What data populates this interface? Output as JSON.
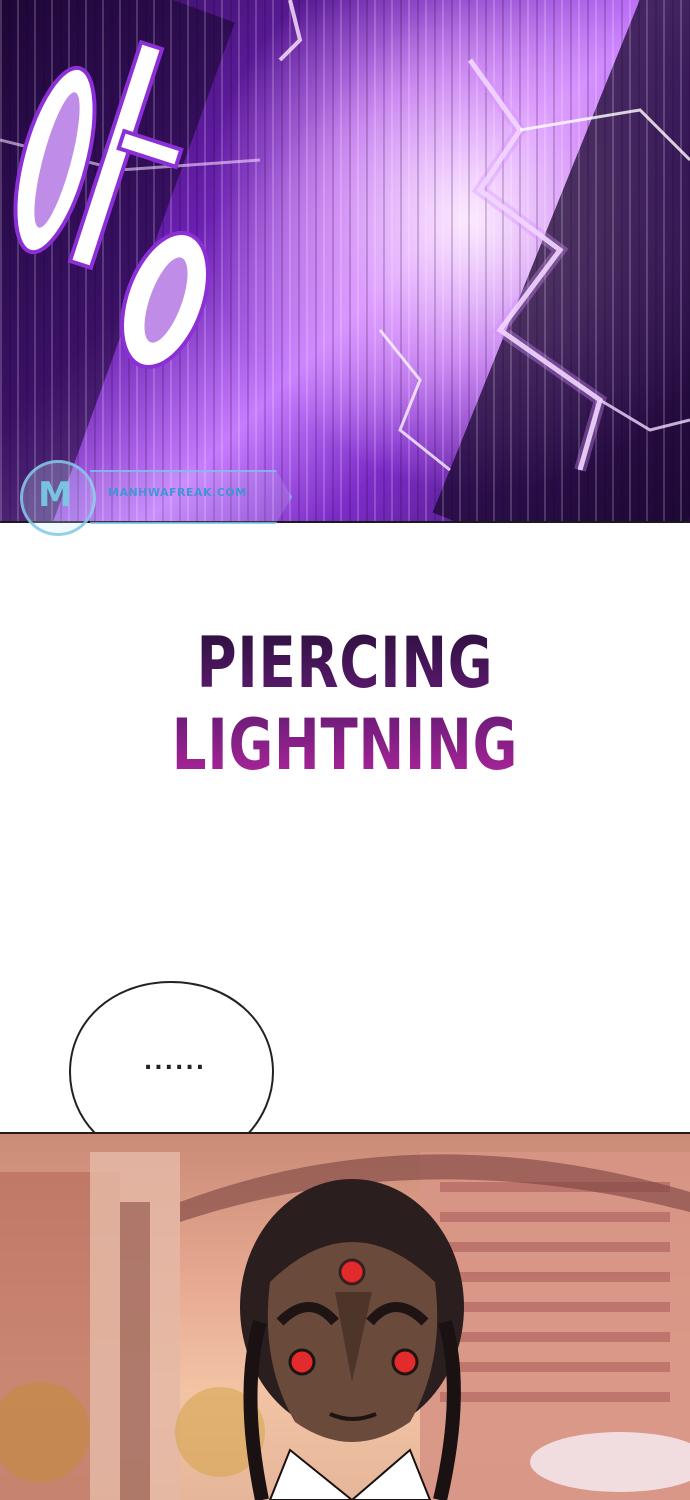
{
  "panels": {
    "top": {
      "sfx_text": "아앙"
    },
    "watermark": {
      "site": "MANHWAFREAK.COM",
      "logo_letter": "M"
    },
    "caption": {
      "title": "PIERCING LIGHTNING"
    },
    "speech_bubble": {
      "text": "......"
    }
  },
  "colors": {
    "lightning_purple": "#8b2fd6",
    "title_top": "#2a0f3a",
    "title_bottom": "#b2259e",
    "mask_red": "#e32b2b"
  }
}
